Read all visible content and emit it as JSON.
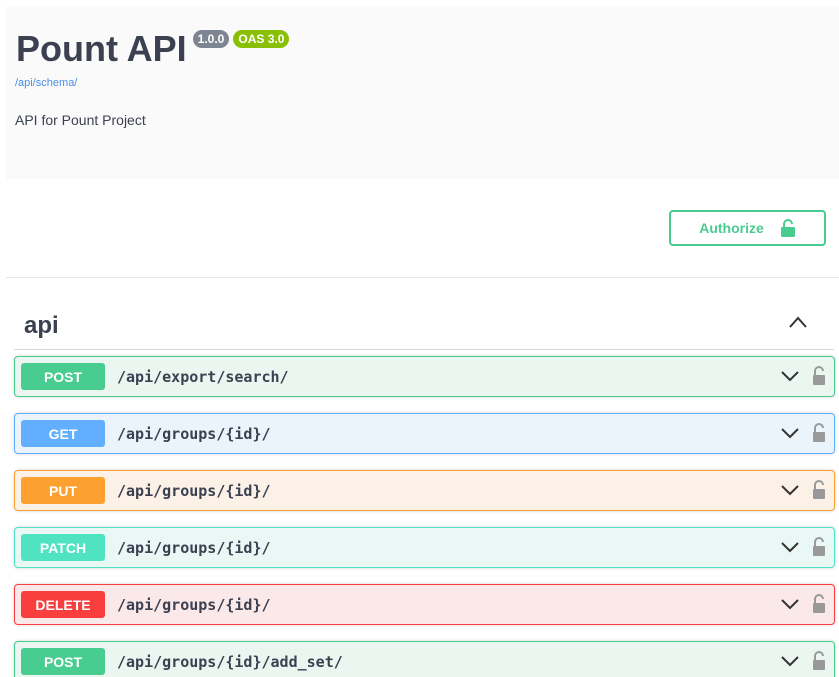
{
  "info": {
    "title": "Pount API",
    "version": "1.0.0",
    "oas": "OAS 3.0",
    "schema_link": "/api/schema/",
    "description": "API for Pount Project"
  },
  "authorize": {
    "label": "Authorize",
    "icon": "lock-icon",
    "color": "#49cc90"
  },
  "tag": {
    "name": "api",
    "toggle_icon": "chevron-up-icon"
  },
  "operations": [
    {
      "method": "POST",
      "path": "/api/export/search/",
      "color": "#49cc90"
    },
    {
      "method": "GET",
      "path": "/api/groups/{id}/",
      "color": "#61affe"
    },
    {
      "method": "PUT",
      "path": "/api/groups/{id}/",
      "color": "#fca130"
    },
    {
      "method": "PATCH",
      "path": "/api/groups/{id}/",
      "color": "#50e3c2"
    },
    {
      "method": "DELETE",
      "path": "/api/groups/{id}/",
      "color": "#f93e3e"
    },
    {
      "method": "POST",
      "path": "/api/groups/{id}/add_set/",
      "color": "#49cc90"
    }
  ]
}
